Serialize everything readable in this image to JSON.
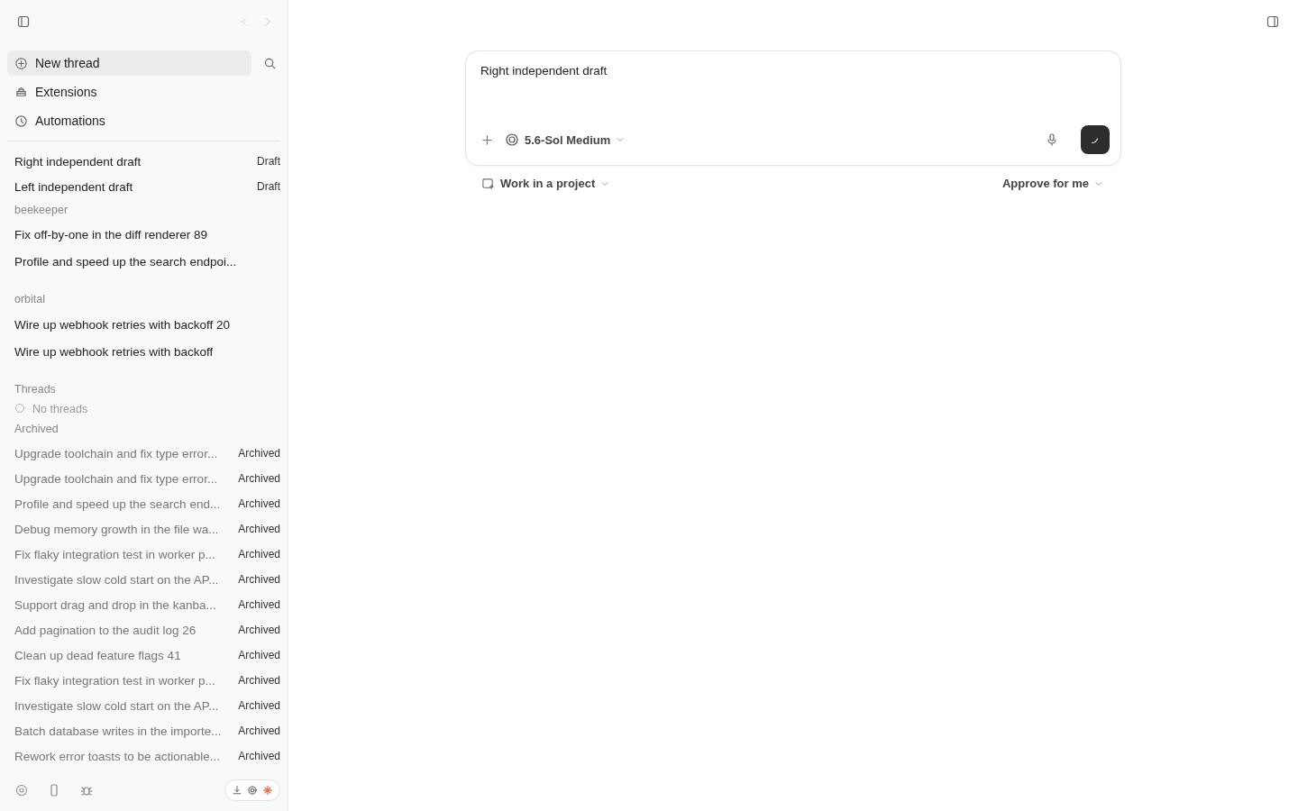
{
  "sidebar": {
    "nav": [
      {
        "kind": "new",
        "label": "New thread",
        "selected": true
      },
      {
        "kind": "extensions",
        "label": "Extensions",
        "selected": false
      },
      {
        "kind": "automations",
        "label": "Automations",
        "selected": false
      }
    ],
    "drafts": [
      {
        "title": "Right independent draft",
        "tag": "Draft"
      },
      {
        "title": "Left independent draft",
        "tag": "Draft"
      }
    ],
    "projects": [
      {
        "name": "beekeeper",
        "threads": [
          "Fix off-by-one in the diff renderer 89",
          "Profile and speed up the search endpoi..."
        ]
      },
      {
        "name": "orbital",
        "threads": [
          "Wire up webhook retries with backoff 20",
          "Wire up webhook retries with backoff"
        ]
      }
    ],
    "threads": {
      "heading": "Threads",
      "empty": "No threads"
    },
    "archived": {
      "heading": "Archived",
      "items": [
        {
          "title": "Upgrade toolchain and fix type error...",
          "tag": "Archived"
        },
        {
          "title": "Upgrade toolchain and fix type error...",
          "tag": "Archived"
        },
        {
          "title": "Profile and speed up the search end...",
          "tag": "Archived"
        },
        {
          "title": "Debug memory growth in the file wa...",
          "tag": "Archived"
        },
        {
          "title": "Fix flaky integration test in worker p...",
          "tag": "Archived"
        },
        {
          "title": "Investigate slow cold start on the AP...",
          "tag": "Archived"
        },
        {
          "title": "Support drag and drop in the kanba...",
          "tag": "Archived"
        },
        {
          "title": "Add pagination to the audit log 26",
          "tag": "Archived"
        },
        {
          "title": "Clean up dead feature flags 41",
          "tag": "Archived"
        },
        {
          "title": "Fix flaky integration test in worker p...",
          "tag": "Archived"
        },
        {
          "title": "Investigate slow cold start on the AP...",
          "tag": "Archived"
        },
        {
          "title": "Batch database writes in the importe...",
          "tag": "Archived"
        },
        {
          "title": "Rework error toasts to be actionable...",
          "tag": "Archived"
        }
      ]
    }
  },
  "composer": {
    "value": "Right independent draft",
    "model": "5.6-Sol Medium",
    "project": "Work in a project",
    "approval": "Approve for me"
  }
}
